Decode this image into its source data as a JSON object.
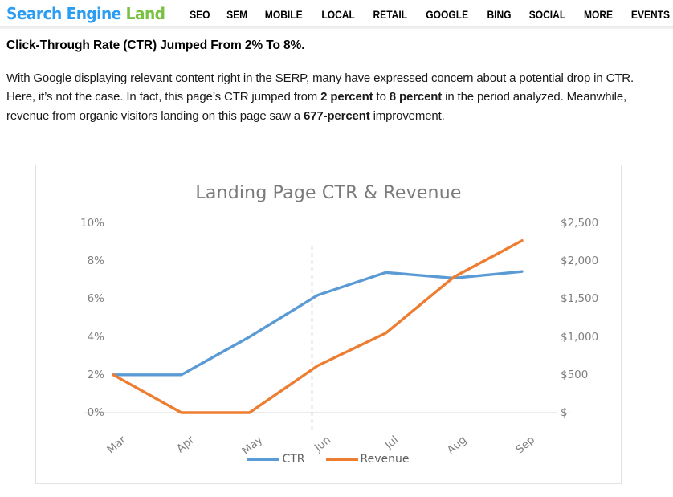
{
  "site": {
    "logo_part1": "Search Engine",
    "logo_part2": "Land",
    "logo_color_blue": "#2b9ef4",
    "logo_color_green": "#7ac143",
    "nav": [
      {
        "label": "SEO"
      },
      {
        "label": "SEM"
      },
      {
        "label": "MOBILE"
      },
      {
        "label": "LOCAL"
      },
      {
        "label": "RETAIL"
      },
      {
        "label": "GOOGLE"
      },
      {
        "label": "BING"
      },
      {
        "label": "SOCIAL"
      },
      {
        "label": "MORE"
      },
      {
        "label": "EVENTS"
      }
    ]
  },
  "article": {
    "headline": "Click-Through Rate (CTR) Jumped From 2% To 8%.",
    "paragraph": {
      "seg1": "With Google displaying relevant content right in the SERP, many have expressed concern about a potential drop in CTR. Here, it’s not the case. In fact, this page’s CTR jumped from ",
      "bold1": "2 percent",
      "seg2": " to ",
      "bold2": "8 percent",
      "seg3": " in the period analyzed. Meanwhile, revenue from organic visitors landing on this page saw a ",
      "bold3": "677-percent",
      "seg4": " improvement."
    }
  },
  "chart_data": {
    "type": "line",
    "title": "Landing Page CTR & Revenue",
    "xlabel": "",
    "ylabel": "",
    "grid": false,
    "legend_position": "bottom",
    "categories": [
      "Mar",
      "Apr",
      "May",
      "Jun",
      "Jul",
      "Aug",
      "Sep"
    ],
    "axes": {
      "left": {
        "name": "CTR",
        "ticks": [
          "0%",
          "2%",
          "4%",
          "6%",
          "8%",
          "10%"
        ],
        "tick_values": [
          0,
          2,
          4,
          6,
          8,
          10
        ],
        "ylim": [
          0,
          10
        ],
        "unit": "percent"
      },
      "right": {
        "name": "Revenue",
        "ticks": [
          "$-",
          "$500",
          "$1,000",
          "$1,500",
          "$2,000",
          "$2,500"
        ],
        "tick_values": [
          0,
          500,
          1000,
          1500,
          2000,
          2500
        ],
        "ylim": [
          0,
          2500
        ],
        "unit": "USD"
      }
    },
    "series": [
      {
        "name": "CTR",
        "color": "#5B9BD5",
        "axis": "left",
        "values": [
          2.0,
          2.0,
          4.0,
          6.2,
          7.4,
          7.1,
          7.45
        ]
      },
      {
        "name": "Revenue",
        "color": "#ED7D31",
        "axis": "right",
        "values": [
          500,
          0,
          0,
          620,
          1050,
          1790,
          2270
        ]
      }
    ],
    "annotations": [
      {
        "type": "vertical-dashed-line",
        "x_position": "between May and Jun",
        "color": "#595959"
      }
    ]
  }
}
